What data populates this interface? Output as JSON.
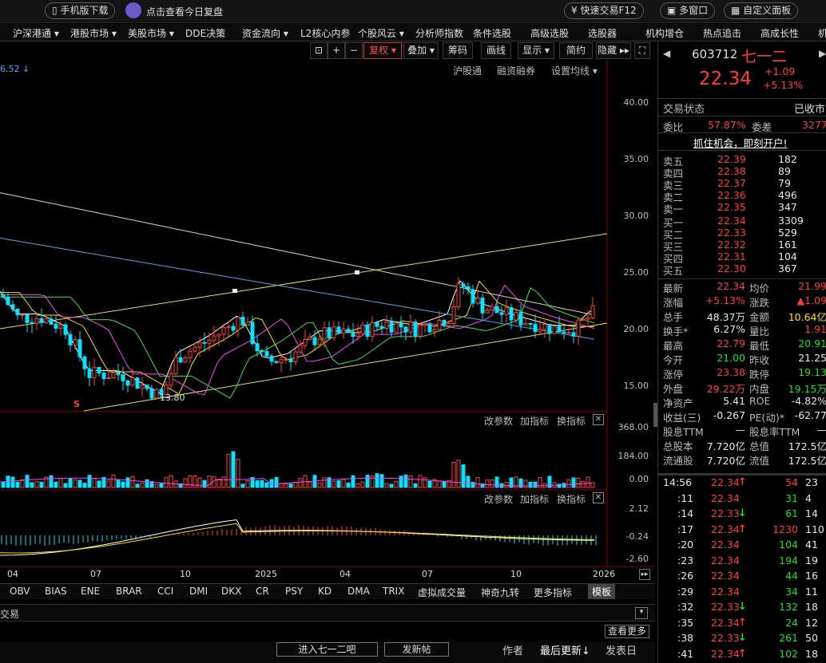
{
  "topbar": {
    "app_download": "手机版下载",
    "daily_review": "点击查看今日复盘",
    "quick_trade": "快速交易F12",
    "multi_window": "多窗口",
    "custom_layout": "自定义面板"
  },
  "menu": [
    "沪深港通 ▾",
    "港股市场 ▾",
    "美股市场 ▾",
    "DDE决策",
    "资金流向 ▾",
    "L2核心内参",
    "个股风云 ▾",
    "分析师指数",
    "条件选股",
    "高级选股",
    "选股器",
    "机构增仓",
    "热点追击",
    "高成长性",
    "机"
  ],
  "toolbar": {
    "restore_right": "复权",
    "overlay": "叠加",
    "chips": "筹码",
    "draw": "画线",
    "display": "显示",
    "simple": "简约",
    "hide": "隐藏"
  },
  "chart_header": {
    "ma_value": "6.52",
    "hk_connect": "沪股通",
    "margin": "融资融券",
    "ma_settings": "设置均线"
  },
  "price_axis": [
    "40.00",
    "35.00",
    "30.00",
    "25.00",
    "20.00",
    "15.00"
  ],
  "low_label": "13.80",
  "s_marker": "S",
  "vol_panel": {
    "edit": "改参数",
    "add": "加指标",
    "switch": "换指标",
    "axis": [
      "368.00",
      "184.00",
      "0.00"
    ]
  },
  "macd_panel": {
    "edit": "改参数",
    "add": "加指标",
    "switch": "换指标",
    "axis": [
      "2.12",
      "-0.24",
      "-2.60"
    ]
  },
  "x_axis": [
    "04",
    "07",
    "10",
    "2025",
    "04",
    "07",
    "10",
    "2026"
  ],
  "indicator_tabs": [
    "OBV",
    "BIAS",
    "ENE",
    "BRAR",
    "CCI",
    "DMI",
    "DKX",
    "CR",
    "PSY",
    "KD",
    "DMA",
    "TRIX",
    "虚拟成交量",
    "神奇九转",
    "更多指标",
    "模板"
  ],
  "bottom": {
    "trade_label": "交易",
    "check_more": "查看更多",
    "enter_forum": "进入七一二吧",
    "post": "发新帖",
    "author": "作者",
    "latest_update": "最后更新↓",
    "post_date": "发表日"
  },
  "chart_data": {
    "type": "candlestick",
    "title": "603712 七一二",
    "x_ticks": [
      "04",
      "07",
      "10",
      "2025",
      "04",
      "07",
      "10",
      "2026"
    ],
    "price_ticks": [
      40,
      35,
      30,
      25,
      20,
      15
    ],
    "low_marked": 13.8,
    "volume_ticks": [
      368,
      184,
      0
    ],
    "macd_ticks": [
      2.12,
      -0.24,
      -2.6
    ]
  },
  "quote": {
    "code": "603712",
    "name": "七一二",
    "price": "22.34",
    "change": "+1.09",
    "pct": "+5.13%",
    "status_label": "交易状态",
    "status": "已收市",
    "weibi_label": "委比",
    "weibi": "57.87%",
    "weicha_label": "委差",
    "weicha": "3277",
    "promo": "抓住机会，即刻开户!"
  },
  "asks": [
    {
      "label": "卖五",
      "price": "22.39",
      "vol": "182"
    },
    {
      "label": "卖四",
      "price": "22.38",
      "vol": "89"
    },
    {
      "label": "卖三",
      "price": "22.37",
      "vol": "79"
    },
    {
      "label": "卖二",
      "price": "22.36",
      "vol": "496"
    },
    {
      "label": "卖一",
      "price": "22.35",
      "vol": "347"
    }
  ],
  "bids": [
    {
      "label": "买一",
      "price": "22.34",
      "vol": "3309"
    },
    {
      "label": "买二",
      "price": "22.33",
      "vol": "529"
    },
    {
      "label": "买三",
      "price": "22.32",
      "vol": "161"
    },
    {
      "label": "买四",
      "price": "22.31",
      "vol": "104"
    },
    {
      "label": "买五",
      "price": "22.30",
      "vol": "367"
    }
  ],
  "stats": [
    {
      "l1": "最新",
      "v1": "22.34",
      "c1": "red",
      "l2": "均价",
      "v2": "21.99",
      "c2": "red"
    },
    {
      "l1": "涨幅",
      "v1": "+5.13%",
      "c1": "red",
      "l2": "涨跌",
      "v2": "▲1.09",
      "c2": "red"
    },
    {
      "l1": "总手",
      "v1": "48.37万",
      "c1": "wht",
      "l2": "金额",
      "v2": "10.64亿",
      "c2": "yel"
    },
    {
      "l1": "换手*",
      "v1": "6.27%",
      "c1": "wht",
      "l2": "量比",
      "v2": "1.91",
      "c2": "red"
    },
    {
      "l1": "最高",
      "v1": "22.79",
      "c1": "red",
      "l2": "最低",
      "v2": "20.91",
      "c2": "grn"
    },
    {
      "l1": "今开",
      "v1": "21.00",
      "c1": "grn",
      "l2": "昨收",
      "v2": "21.25",
      "c2": "wht"
    },
    {
      "l1": "涨停",
      "v1": "23.38",
      "c1": "red",
      "l2": "跌停",
      "v2": "19.13",
      "c2": "grn"
    },
    {
      "l1": "外盘",
      "v1": "29.22万",
      "c1": "red",
      "l2": "内盘",
      "v2": "19.15万",
      "c2": "grn"
    },
    {
      "l1": "净资产",
      "v1": "5.41",
      "c1": "wht",
      "l2": "ROE",
      "v2": "-4.82%",
      "c2": "wht"
    },
    {
      "l1": "收益(三)",
      "v1": "-0.267",
      "c1": "wht",
      "l2": "PE(动)*",
      "v2": "-62.77",
      "c2": "wht"
    },
    {
      "l1": "股息TTM",
      "v1": "—",
      "c1": "wht",
      "l2": "股息率TTM",
      "v2": "—",
      "c2": "wht"
    },
    {
      "l1": "总股本",
      "v1": "7.720亿",
      "c1": "wht",
      "l2": "总值",
      "v2": "172.5亿",
      "c2": "wht"
    },
    {
      "l1": "流通股",
      "v1": "7.720亿",
      "c1": "wht",
      "l2": "流值",
      "v2": "172.5亿",
      "c2": "wht"
    }
  ],
  "ticks": [
    {
      "t": "14:56",
      "p": "22.34",
      "arrow": "↑",
      "pc": "red",
      "v": "54",
      "n": "23"
    },
    {
      "t": ":11",
      "p": "22.34",
      "arrow": "",
      "pc": "red",
      "v": "31",
      "n": "4"
    },
    {
      "t": ":14",
      "p": "22.33",
      "arrow": "↓",
      "pc": "red",
      "v": "61",
      "n": "14"
    },
    {
      "t": ":17",
      "p": "22.34",
      "arrow": "↑",
      "pc": "red",
      "v": "1230",
      "n": "110"
    },
    {
      "t": ":20",
      "p": "22.34",
      "arrow": "",
      "pc": "red",
      "v": "104",
      "n": "41"
    },
    {
      "t": ":23",
      "p": "22.34",
      "arrow": "",
      "pc": "red",
      "v": "194",
      "n": "19"
    },
    {
      "t": ":26",
      "p": "22.34",
      "arrow": "",
      "pc": "red",
      "v": "44",
      "n": "16"
    },
    {
      "t": ":29",
      "p": "22.34",
      "arrow": "",
      "pc": "red",
      "v": "34",
      "n": "11"
    },
    {
      "t": ":32",
      "p": "22.33",
      "arrow": "↓",
      "pc": "red",
      "v": "132",
      "n": "18"
    },
    {
      "t": ":35",
      "p": "22.34",
      "arrow": "↑",
      "pc": "red",
      "v": "24",
      "n": "12"
    },
    {
      "t": ":38",
      "p": "22.33",
      "arrow": "↓",
      "pc": "red",
      "v": "261",
      "n": "50"
    },
    {
      "t": ":41",
      "p": "22.34",
      "arrow": "↑",
      "pc": "red",
      "v": "102",
      "n": "18"
    }
  ]
}
